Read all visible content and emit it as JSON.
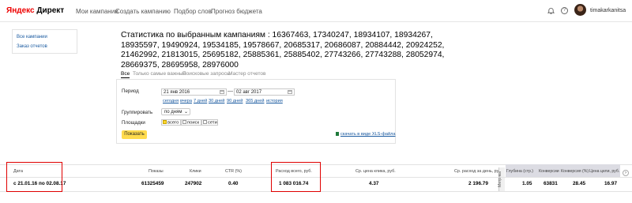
{
  "header": {
    "logo_brand": "Яндекс",
    "logo_product": "Директ",
    "nav": [
      "Мои кампании",
      "Создать кампанию",
      "Подбор слов",
      "Прогноз бюджета"
    ],
    "username": "timakarkanitsa",
    "help_symbol": "?"
  },
  "sidebar": {
    "links": [
      "Все кампании",
      "Заказ отчетов"
    ]
  },
  "page": {
    "title": "Статистика по выбранным кампаниям : 16367463, 17340247, 18934107, 18934267, 18935597, 19490924, 19534185, 19578667, 20685317, 20686087, 20884442, 20924252, 21462992, 21813015, 25695182, 25885361, 25885402, 27743266, 27743288, 28052974, 28669375, 28695958, 28976000"
  },
  "tabs": [
    {
      "label": "Все",
      "active": true
    },
    {
      "label": "Только самые важные",
      "active": false
    },
    {
      "label": "Поисковые запросы",
      "active": false
    },
    {
      "label": "Мастер отчетов",
      "active": false
    }
  ],
  "filters": {
    "period_label": "Период",
    "date_from": "21 янв 2016",
    "date_to": "02 авг 2017",
    "date_separator": "—",
    "quick_periods": [
      "сегодня",
      "вчера",
      "7 дней",
      "30 дней",
      "90 дней",
      "365 дней",
      "история"
    ],
    "group_label": "Группировать",
    "group_value": "по дням",
    "platforms_label": "Площадки",
    "platforms": [
      {
        "label": "всего",
        "checked": true
      },
      {
        "label": "поиск",
        "checked": false
      },
      {
        "label": "сети",
        "checked": false
      }
    ],
    "show_button": "Показать",
    "xls_link": "скачать в виде XLS-файла"
  },
  "table": {
    "headers": {
      "date": "Дата",
      "impressions": "Показы",
      "clicks": "Клики",
      "ctr": "CTR (%)",
      "spend": "Расход всего, руб.",
      "avg_cpc": "Ср. цена клика, руб.",
      "avg_daily": "Ср. расход за день, руб.",
      "metrika": "Метрика",
      "depth": "Глубина (стр.)",
      "conversions": "Конверсии",
      "conv_rate": "Конверсия (%)",
      "cpa": "Цена цели, руб."
    },
    "row": {
      "date": "с 21.01.16 по 02.08.17",
      "impressions": "61325459",
      "clicks": "247902",
      "ctr": "0.40",
      "spend": "1 083 016.74",
      "avg_cpc": "4.37",
      "avg_daily": "2 196.79",
      "depth": "1.05",
      "conversions": "63831",
      "conv_rate": "28.45",
      "cpa": "16.97"
    }
  },
  "colors": {
    "accent": "#ffdb4d",
    "link": "#1a5aa0",
    "brand_red": "#ee0000",
    "highlight": "#e00000"
  }
}
